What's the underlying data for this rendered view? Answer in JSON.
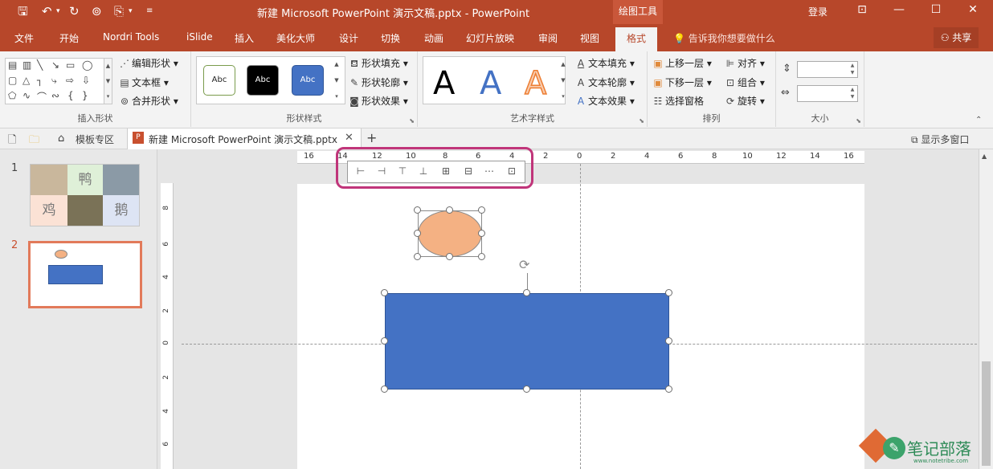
{
  "window": {
    "title": "新建 Microsoft PowerPoint 演示文稿.pptx  -  PowerPoint",
    "context_tab_group": "绘图工具",
    "login": "登录",
    "controls": [
      "⊡",
      "—",
      "☐",
      "✕"
    ]
  },
  "ribbon_tabs": [
    "文件",
    "开始",
    "Nordri Tools",
    "iSlide",
    "插入",
    "美化大师",
    "设计",
    "切换",
    "动画",
    "幻灯片放映",
    "审阅",
    "视图",
    "格式"
  ],
  "active_tab": "格式",
  "tell_me": "告诉我你想要做什么",
  "share": "共享",
  "groups": {
    "insert_shapes": {
      "label": "插入形状",
      "edit_shape": "编辑形状",
      "text_box": "文本框",
      "merge_shapes": "合并形状"
    },
    "shape_styles": {
      "label": "形状样式",
      "styles": [
        "Abc",
        "Abc",
        "Abc"
      ],
      "fill": "形状填充",
      "outline": "形状轮廓",
      "effects": "形状效果"
    },
    "wordart": {
      "label": "艺术字样式",
      "letters": [
        "A",
        "A",
        "A"
      ],
      "text_fill": "文本填充",
      "text_outline": "文本轮廓",
      "text_effects": "文本效果"
    },
    "arrange": {
      "label": "排列",
      "bring_forward": "上移一层",
      "send_backward": "下移一层",
      "selection_pane": "选择窗格",
      "align": "对齐",
      "group": "组合",
      "rotate": "旋转"
    },
    "size": {
      "label": "大小",
      "height": "",
      "width": ""
    }
  },
  "doc_tabs": {
    "template": "模板专区",
    "document": "新建 Microsoft PowerPoint 演示文稿.pptx",
    "multi_window": "显示多窗口"
  },
  "slides": {
    "numbers": [
      "1",
      "2"
    ],
    "thumb1_labels": [
      "鸭",
      "鸡",
      "鹅"
    ]
  },
  "ruler": {
    "horizontal": [
      "16",
      "14",
      "12",
      "10",
      "8",
      "6",
      "4",
      "2",
      "0",
      "2",
      "4",
      "6",
      "8",
      "10",
      "12",
      "14",
      "16"
    ],
    "vertical": [
      "8",
      "6",
      "4",
      "2",
      "0",
      "2",
      "4",
      "6"
    ]
  },
  "watermark": {
    "text": "笔记部落",
    "url": "www.notetribe.com"
  },
  "colors": {
    "brand": "#b7472a",
    "rectangle_fill": "#4472c4",
    "ellipse_fill": "#f4b183",
    "highlight": "#c0357a"
  }
}
